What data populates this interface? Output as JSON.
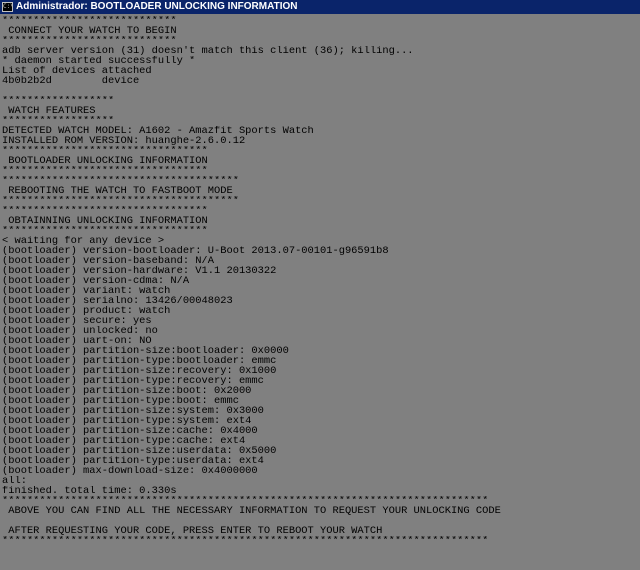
{
  "window": {
    "title": "Administrador:  BOOTLOADER UNLOCKING INFORMATION",
    "icon": "C:\\",
    "icon_name": "console-icon"
  },
  "colors": {
    "titlebar": "#0a246a",
    "console_bg": "#808080",
    "console_fg": "#000000"
  },
  "console": {
    "lines": [
      "****************************",
      " CONNECT YOUR WATCH TO BEGIN",
      "****************************",
      "adb server version (31) doesn't match this client (36); killing...",
      "* daemon started successfully *",
      "List of devices attached",
      "4b0b2b2d        device",
      "",
      "******************",
      " WATCH FEATURES",
      "******************",
      "DETECTED WATCH MODEL: A1602 - Amazfit Sports Watch",
      "INSTALLED ROM VERSION: huanghe-2.6.0.12",
      "*********************************",
      " BOOTLOADER UNLOCKING INFORMATION",
      "*********************************",
      "**************************************",
      " REBOOTING THE WATCH TO FASTBOOT MODE",
      "**************************************",
      "*********************************",
      " OBTAINNING UNLOCKING INFORMATION",
      "*********************************",
      "< waiting for any device >",
      "(bootloader) version-bootloader: U-Boot 2013.07-00101-g96591b8",
      "(bootloader) version-baseband: N/A",
      "(bootloader) version-hardware: V1.1 20130322",
      "(bootloader) version-cdma: N/A",
      "(bootloader) variant: watch",
      "(bootloader) serialno: 13426/00048023",
      "(bootloader) product: watch",
      "(bootloader) secure: yes",
      "(bootloader) unlocked: no",
      "(bootloader) uart-on: NO",
      "(bootloader) partition-size:bootloader: 0x0000",
      "(bootloader) partition-type:bootloader: emmc",
      "(bootloader) partition-size:recovery: 0x1000",
      "(bootloader) partition-type:recovery: emmc",
      "(bootloader) partition-size:boot: 0x2000",
      "(bootloader) partition-type:boot: emmc",
      "(bootloader) partition-size:system: 0x3000",
      "(bootloader) partition-type:system: ext4",
      "(bootloader) partition-size:cache: 0x4000",
      "(bootloader) partition-type:cache: ext4",
      "(bootloader) partition-size:userdata: 0x5000",
      "(bootloader) partition-type:userdata: ext4",
      "(bootloader) max-download-size: 0x4000000",
      "all:",
      "finished. total time: 0.330s",
      "******************************************************************************",
      " ABOVE YOU CAN FIND ALL THE NECESSARY INFORMATION TO REQUEST YOUR UNLOCKING CODE",
      "",
      " AFTER REQUESTING YOUR CODE, PRESS ENTER TO REBOOT YOUR WATCH",
      "******************************************************************************",
      ""
    ]
  }
}
